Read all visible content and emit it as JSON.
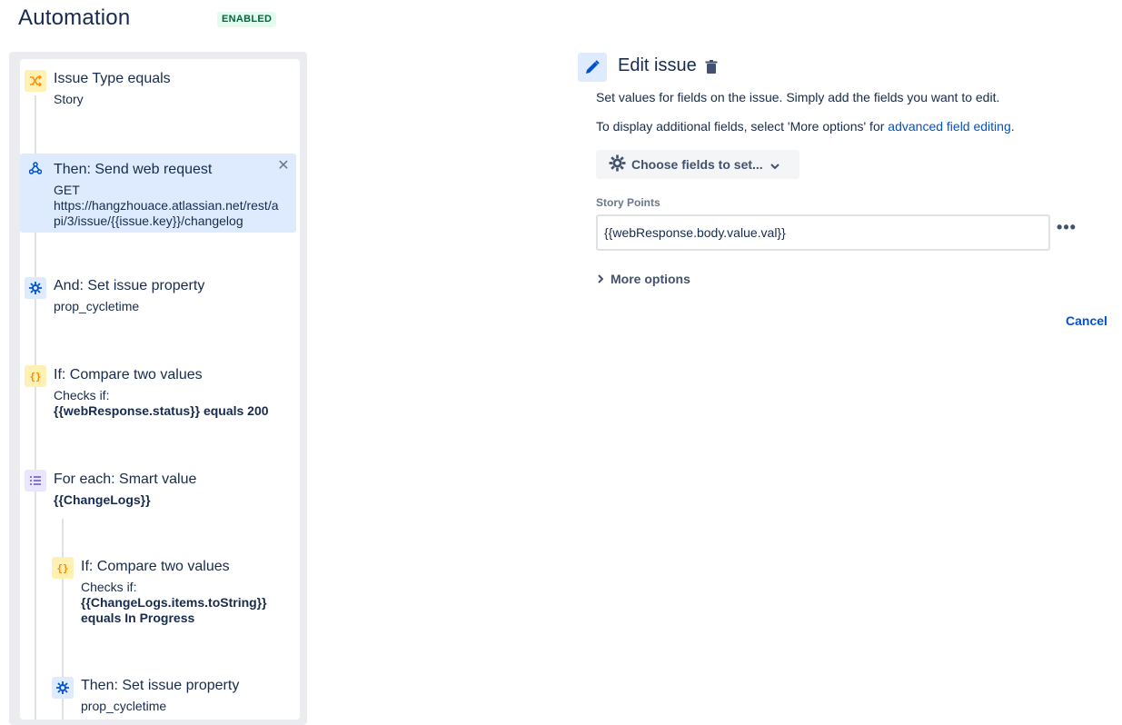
{
  "header": {
    "title": "Automation",
    "status": "ENABLED"
  },
  "rule": {
    "components": [
      {
        "title": "Issue Type equals",
        "sub": "Story",
        "icon": "branch-icon"
      },
      {
        "title": "Then: Send web request",
        "sub": [
          "GET",
          "https://hangzhouace.atlassian.net/rest/a",
          "pi/3/issue/{{issue.key}}/changelog"
        ],
        "icon": "webhook-icon"
      },
      {
        "title": "And: Set issue property",
        "sub": "prop_cycletime",
        "icon": "gear-icon"
      },
      {
        "title": "If: Compare two values",
        "sub": [
          "Checks if:",
          "{{webResponse.status}} equals 200"
        ],
        "icon": "braces-icon"
      },
      {
        "title": "For each: Smart value",
        "sub": "{{ChangeLogs}}",
        "icon": "list-icon"
      },
      {
        "title": "If: Compare two values",
        "sub": [
          "Checks if:",
          "{{ChangeLogs.items.toString}}",
          "equals In Progress"
        ],
        "icon": "braces-icon"
      },
      {
        "title": "Then: Set issue property",
        "sub": "prop_cycletime",
        "icon": "gear-icon"
      }
    ]
  },
  "edit": {
    "title": "Edit issue",
    "desc1": "Set values for fields on the issue. Simply add the fields you want to edit.",
    "desc2_prefix": "To display additional fields, select 'More options' for ",
    "desc2_link": "advanced field editing",
    "desc2_suffix": ".",
    "choose_fields": "Choose fields to set...",
    "field_label": "Story Points",
    "field_value": "{{webResponse.body.value.val}}",
    "more_options": "More options",
    "cancel": "Cancel"
  },
  "colors": {
    "accent": "#0052cc",
    "selected_bg": "#deebff",
    "badge_bg": "#e3fcef",
    "badge_text": "#006644"
  }
}
